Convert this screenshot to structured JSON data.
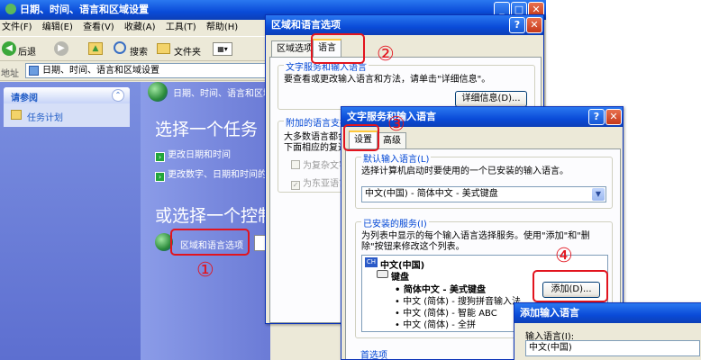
{
  "main_window": {
    "title": "日期、时间、语言和区域设置",
    "menu": [
      "文件(F)",
      "编辑(E)",
      "查看(V)",
      "收藏(A)",
      "工具(T)",
      "帮助(H)"
    ],
    "toolbar": {
      "back": "后退",
      "search": "搜索",
      "folders": "文件夹"
    },
    "address_label": "地址",
    "address_value": "日期、时间、语言和区域设置",
    "see_also": {
      "title": "请参阅",
      "item": "任务计划"
    },
    "header": "日期、时间、语言和区域设置",
    "pick_task": "选择一个任务",
    "tasks": [
      "更改日期和时间",
      "更改数字、日期和时间的"
    ],
    "pick_icon": "或选择一个控制面板",
    "regional_icon_label": "区域和语言选项"
  },
  "regional_dialog": {
    "title": "区域和语言选项",
    "tabs": [
      "区域选项",
      "语言"
    ],
    "group1_title": "文字服务和输入语言",
    "group1_text": "要查看或更改输入语言和方法，请单击\"详细信息\"。",
    "details_button": "详细信息(D)...",
    "group2_title": "附加的语言支持",
    "group2_text1": "大多数语言都会",
    "group2_text2": "下面相应的复选",
    "check1": "为复杂文字",
    "check2": "为东亚语言"
  },
  "text_services_dialog": {
    "title": "文字服务和输入语言",
    "tabs": [
      "设置",
      "高级"
    ],
    "default_group": "默认输入语言(L)",
    "default_text": "选择计算机启动时要使用的一个已安装的输入语言。",
    "default_value": "中文(中国) - 简体中文 - 美式键盘",
    "installed_group": "已安装的服务(I)",
    "installed_text1": "为列表中显示的每个输入语言选择服务。使用\"添加\"和\"删",
    "installed_text2": "除\"按钮来修改这个列表。",
    "tree": {
      "lang_badge": "CH",
      "lang": "中文(中国)",
      "keyboard": "键盘",
      "items": [
        "简体中文 - 美式键盘",
        "中文 (简体) - 搜狗拼音输入法",
        "中文 (简体) - 智能 ABC",
        "中文 (简体) - 全拼"
      ]
    },
    "add_button": "添加(D)...",
    "prefs_label": "首选项"
  },
  "add_dialog": {
    "title": "添加输入语言",
    "label": "输入语言(I):",
    "value": "中文(中国)"
  },
  "annotations": [
    "①",
    "②",
    "③",
    "④"
  ],
  "colors": {
    "annotation_red": "#e2141e",
    "xp_blue": "#0a4bd8",
    "task_pane": "#6b7bd6"
  }
}
